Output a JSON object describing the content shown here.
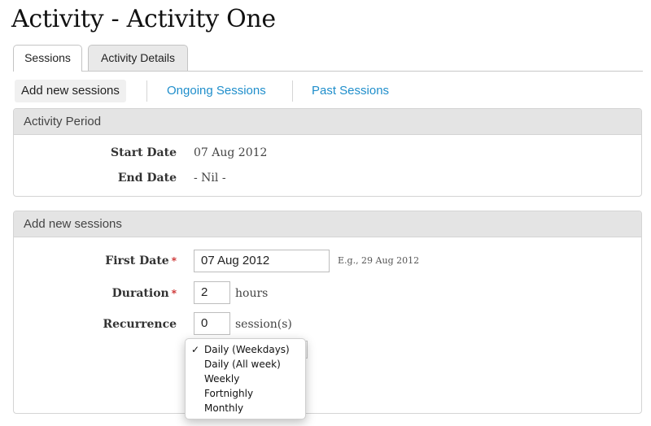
{
  "page": {
    "title": "Activity - Activity One"
  },
  "tabs": [
    {
      "label": "Sessions",
      "active": true
    },
    {
      "label": "Activity Details",
      "active": false
    }
  ],
  "subnav": {
    "add_new": "Add new sessions",
    "ongoing": "Ongoing Sessions",
    "past": "Past Sessions"
  },
  "activity_period": {
    "header": "Activity Period",
    "start_label": "Start Date",
    "start_value": "07 Aug 2012",
    "end_label": "End Date",
    "end_value": "- Nil -"
  },
  "add_sessions": {
    "header": "Add new sessions",
    "first_date_label": "First Date",
    "first_date_value": "07 Aug 2012",
    "first_date_hint": "E.g., 29 Aug 2012",
    "duration_label": "Duration",
    "duration_value": "2",
    "duration_unit": "hours",
    "recurrence_label": "Recurrence",
    "recurrence_value": "0",
    "recurrence_unit": "session(s)",
    "required_mark": "*"
  },
  "recurrence_dropdown": {
    "selected": "Daily (Weekdays)",
    "check": "✓",
    "options": [
      "Daily (Weekdays)",
      "Daily (All week)",
      "Weekly",
      "Fortnighly",
      "Monthly"
    ]
  },
  "colors": {
    "link": "#1f8ecb",
    "required": "#c82020",
    "panel_header": "#e4e4e4"
  }
}
